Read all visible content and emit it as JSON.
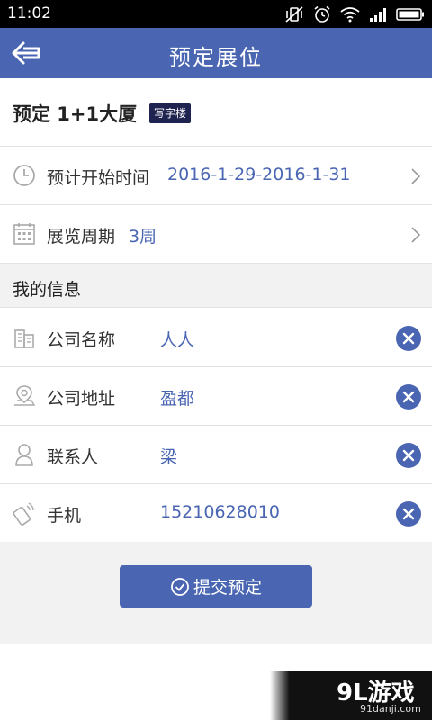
{
  "status_bar": {
    "time": "11:02"
  },
  "header": {
    "title": "预定展位"
  },
  "venue": {
    "name": "预定 1+1大厦",
    "tag": "写字楼"
  },
  "booking": {
    "start_time": {
      "label": "预计开始时间",
      "value": "2016-1-29-2016-1-31"
    },
    "period": {
      "label": "展览周期",
      "value": "3周"
    }
  },
  "my_info": {
    "section_title": "我的信息",
    "company_name": {
      "label": "公司名称",
      "value": "人人"
    },
    "company_address": {
      "label": "公司地址",
      "value": "盈都"
    },
    "contact": {
      "label": "联系人",
      "value": "梁"
    },
    "phone": {
      "label": "手机",
      "value": "15210628010"
    }
  },
  "submit": {
    "label": "提交预定"
  },
  "watermark": {
    "brand": "9L游戏",
    "url": "91danji.com"
  },
  "colors": {
    "primary": "#4a66b2",
    "tag_bg": "#1f2350",
    "background": "#f2f2f2"
  }
}
